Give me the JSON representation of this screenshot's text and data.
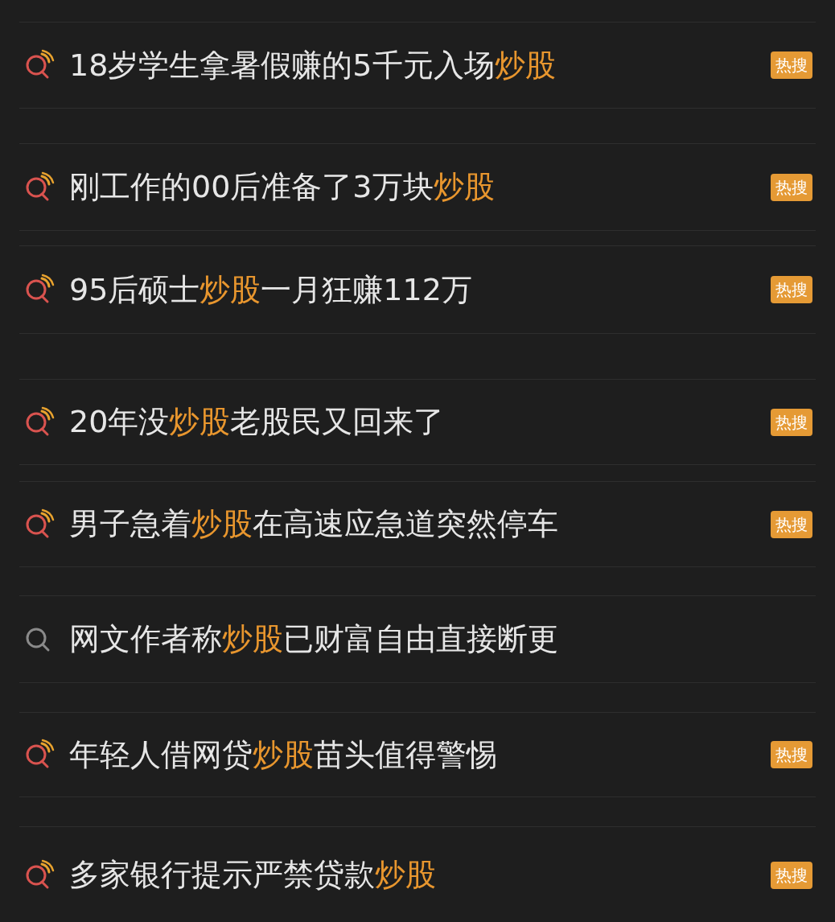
{
  "suggestions": [
    {
      "kind": "hot",
      "parts": [
        {
          "text": "18岁学生拿暑假赚的5千元入场",
          "highlight": false
        },
        {
          "text": "炒股",
          "highlight": true
        }
      ],
      "badge": "热搜"
    },
    {
      "kind": "hot",
      "parts": [
        {
          "text": "刚工作的00后准备了3万块",
          "highlight": false
        },
        {
          "text": "炒股",
          "highlight": true
        }
      ],
      "badge": "热搜"
    },
    {
      "kind": "hot",
      "parts": [
        {
          "text": "95后硕士",
          "highlight": false
        },
        {
          "text": "炒股",
          "highlight": true
        },
        {
          "text": "一月狂赚112万",
          "highlight": false
        }
      ],
      "badge": "热搜"
    },
    {
      "kind": "hot",
      "parts": [
        {
          "text": "20年没",
          "highlight": false
        },
        {
          "text": "炒股",
          "highlight": true
        },
        {
          "text": "老股民又回来了",
          "highlight": false
        }
      ],
      "badge": "热搜"
    },
    {
      "kind": "hot",
      "parts": [
        {
          "text": "男子急着",
          "highlight": false
        },
        {
          "text": "炒股",
          "highlight": true
        },
        {
          "text": "在高速应急道突然停车",
          "highlight": false
        }
      ],
      "badge": "热搜"
    },
    {
      "kind": "plain",
      "parts": [
        {
          "text": "网文作者称",
          "highlight": false
        },
        {
          "text": "炒股",
          "highlight": true
        },
        {
          "text": "已财富自由直接断更",
          "highlight": false
        }
      ]
    },
    {
      "kind": "hot",
      "parts": [
        {
          "text": "年轻人借网贷",
          "highlight": false
        },
        {
          "text": "炒股",
          "highlight": true
        },
        {
          "text": "苗头值得警惕",
          "highlight": false
        }
      ],
      "badge": "热搜"
    },
    {
      "kind": "hot",
      "parts": [
        {
          "text": "多家银行提示严禁贷款",
          "highlight": false
        },
        {
          "text": "炒股",
          "highlight": true
        }
      ],
      "badge": "热搜"
    }
  ]
}
